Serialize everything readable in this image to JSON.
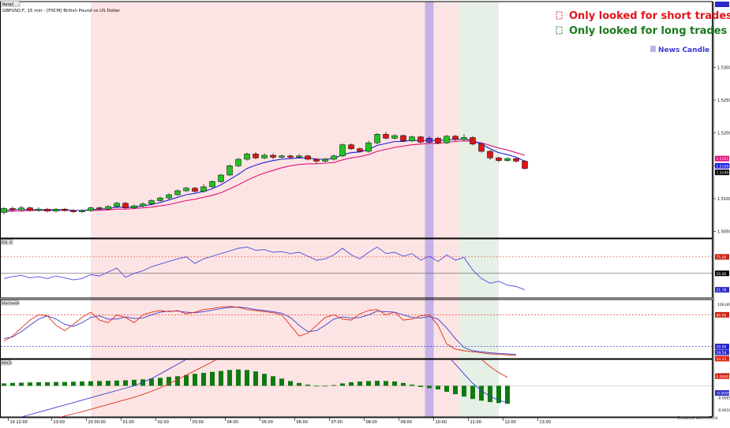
{
  "window": {
    "title_tag": "Retail",
    "symbol_line": "GBPUSD.F, 15 min - [FXCM] British Pound vs US Dollar",
    "footer": "Created with XTick"
  },
  "legend": {
    "short_label": "Only looked for short trades",
    "long_label": "Only looked for long trades",
    "news_label": "News Candle",
    "short_color": "#e4141b",
    "long_color": "#1a7a1a",
    "news_color": "#5a5ae0"
  },
  "colors": {
    "short_zone": "#fde4e4",
    "long_zone": "#e6f0e6",
    "news_band": "#c3b3e6",
    "bull": "#22c322",
    "bear": "#e01515",
    "news_candle": "#6a2fc9",
    "ma_fast": "#1f1fdf",
    "ma_slow": "#e0137a",
    "rsi_line": "#4a4ae0",
    "macd_hist": "#0f7a0f"
  },
  "chart_data": [
    {
      "type": "candlestick",
      "panel": "price",
      "x_unit": "bar index (15 min bars)",
      "ylim": [
        1.504,
        1.54
      ],
      "y_ticks": [
        "1.5300",
        "1.5250",
        "1.5200",
        "1.5150",
        "1.5100",
        "1.5050"
      ],
      "x_ticks": [
        {
          "i": 0,
          "label": "19 22:00"
        },
        {
          "i": 5,
          "label": "23:00"
        },
        {
          "i": 9,
          "label": "20 00:00"
        },
        {
          "i": 13,
          "label": "01:00"
        },
        {
          "i": 17,
          "label": "02:00"
        },
        {
          "i": 21,
          "label": "03:00"
        },
        {
          "i": 25,
          "label": "04:00"
        },
        {
          "i": 29,
          "label": "05:00"
        },
        {
          "i": 33,
          "label": "06:00"
        },
        {
          "i": 37,
          "label": "07:00"
        },
        {
          "i": 41,
          "label": "08:00"
        },
        {
          "i": 45,
          "label": "09:00"
        },
        {
          "i": 49,
          "label": "10:00"
        },
        {
          "i": 53,
          "label": "11:00"
        },
        {
          "i": 57,
          "label": "12:00"
        },
        {
          "i": 61,
          "label": "13:00"
        }
      ],
      "price_badges": [
        {
          "label": "1.5161",
          "value": 1.5161,
          "color": "#e0137a"
        },
        {
          "label": "1.5150",
          "value": 1.515,
          "color": "#1f1fdf"
        },
        {
          "label": "1.5140",
          "value": 1.514,
          "color": "#000000"
        }
      ],
      "shaded_regions": [
        {
          "name": "Only looked for short trades",
          "from": 10,
          "to": 52.5
        },
        {
          "name": "Only looked for long trades",
          "from": 52.5,
          "to": 57
        },
        {
          "name": "News Candle",
          "from": 48.5,
          "to": 49.5
        }
      ],
      "news_candle_index": 49,
      "candles": [
        [
          1.5079,
          1.5085,
          1.5087,
          1.5076
        ],
        [
          1.5085,
          1.5083,
          1.5088,
          1.508
        ],
        [
          1.5083,
          1.5086,
          1.5089,
          1.5081
        ],
        [
          1.5086,
          1.5082,
          1.5088,
          1.508
        ],
        [
          1.5082,
          1.5084,
          1.5087,
          1.508
        ],
        [
          1.5084,
          1.5081,
          1.5086,
          1.5079
        ],
        [
          1.5081,
          1.5084,
          1.5086,
          1.5079
        ],
        [
          1.5084,
          1.5082,
          1.5086,
          1.508
        ],
        [
          1.5082,
          1.508,
          1.5084,
          1.5078
        ],
        [
          1.508,
          1.5082,
          1.5084,
          1.5078
        ],
        [
          1.5082,
          1.5086,
          1.5088,
          1.508
        ],
        [
          1.5086,
          1.5084,
          1.5088,
          1.5082
        ],
        [
          1.5084,
          1.5088,
          1.509,
          1.5082
        ],
        [
          1.5088,
          1.5093,
          1.5095,
          1.5086
        ],
        [
          1.5093,
          1.5086,
          1.5095,
          1.5084
        ],
        [
          1.5086,
          1.5089,
          1.5091,
          1.5084
        ],
        [
          1.5089,
          1.5092,
          1.5094,
          1.5087
        ],
        [
          1.5092,
          1.5097,
          1.5099,
          1.509
        ],
        [
          1.5097,
          1.5101,
          1.5103,
          1.5095
        ],
        [
          1.5101,
          1.5106,
          1.5108,
          1.5099
        ],
        [
          1.5106,
          1.5112,
          1.5114,
          1.5104
        ],
        [
          1.5112,
          1.5116,
          1.5118,
          1.511
        ],
        [
          1.5116,
          1.5111,
          1.5118,
          1.5109
        ],
        [
          1.5111,
          1.5118,
          1.5122,
          1.5109
        ],
        [
          1.5118,
          1.5126,
          1.5128,
          1.5116
        ],
        [
          1.5126,
          1.5136,
          1.5138,
          1.5124
        ],
        [
          1.5136,
          1.515,
          1.5152,
          1.5134
        ],
        [
          1.515,
          1.516,
          1.5162,
          1.5148
        ],
        [
          1.516,
          1.5168,
          1.517,
          1.5158
        ],
        [
          1.5168,
          1.5162,
          1.5171,
          1.516
        ],
        [
          1.5162,
          1.5166,
          1.5169,
          1.516
        ],
        [
          1.5166,
          1.5163,
          1.5169,
          1.516
        ],
        [
          1.5163,
          1.5165,
          1.5167,
          1.5161
        ],
        [
          1.5165,
          1.5163,
          1.5167,
          1.516
        ],
        [
          1.5163,
          1.5165,
          1.5168,
          1.5161
        ],
        [
          1.5165,
          1.516,
          1.5167,
          1.5158
        ],
        [
          1.516,
          1.5157,
          1.5162,
          1.5153
        ],
        [
          1.5157,
          1.516,
          1.5162,
          1.5155
        ],
        [
          1.516,
          1.5165,
          1.5167,
          1.5158
        ],
        [
          1.5165,
          1.5182,
          1.5184,
          1.5163
        ],
        [
          1.5182,
          1.5176,
          1.5184,
          1.5174
        ],
        [
          1.5176,
          1.5172,
          1.5178,
          1.517
        ],
        [
          1.5172,
          1.5185,
          1.5188,
          1.517
        ],
        [
          1.5185,
          1.5198,
          1.52,
          1.5183
        ],
        [
          1.5198,
          1.5192,
          1.5202,
          1.519
        ],
        [
          1.5192,
          1.5196,
          1.5198,
          1.519
        ],
        [
          1.5196,
          1.5188,
          1.5198,
          1.5186
        ],
        [
          1.5188,
          1.5194,
          1.5196,
          1.5186
        ],
        [
          1.5194,
          1.5186,
          1.5196,
          1.5184
        ],
        [
          1.5186,
          1.5192,
          1.5195,
          1.5184
        ],
        [
          1.5192,
          1.5185,
          1.5194,
          1.5183
        ],
        [
          1.5185,
          1.5195,
          1.5197,
          1.5183
        ],
        [
          1.5195,
          1.519,
          1.5197,
          1.5188
        ],
        [
          1.519,
          1.5193,
          1.5198,
          1.5188
        ],
        [
          1.5193,
          1.5183,
          1.5195,
          1.5181
        ],
        [
          1.5183,
          1.5172,
          1.5185,
          1.517
        ],
        [
          1.5172,
          1.5162,
          1.5174,
          1.5159
        ],
        [
          1.5162,
          1.5158,
          1.5164,
          1.5155
        ],
        [
          1.5158,
          1.5161,
          1.5163,
          1.5156
        ],
        [
          1.5161,
          1.5157,
          1.5163,
          1.5155
        ],
        [
          1.5157,
          1.5146,
          1.5159,
          1.5144
        ]
      ],
      "ma_fast": [
        1.5082,
        1.5083,
        1.5084,
        1.5083,
        1.5083,
        1.5083,
        1.5083,
        1.5083,
        1.5082,
        1.5082,
        1.5083,
        1.5084,
        1.5085,
        1.5087,
        1.5087,
        1.5087,
        1.5089,
        1.5091,
        1.5094,
        1.5098,
        1.5102,
        1.5106,
        1.5108,
        1.5111,
        1.5115,
        1.5121,
        1.5129,
        1.5137,
        1.5146,
        1.5151,
        1.5155,
        1.5158,
        1.516,
        1.5161,
        1.5162,
        1.5162,
        1.516,
        1.516,
        1.5161,
        1.5167,
        1.517,
        1.5171,
        1.5175,
        1.5181,
        1.5184,
        1.5187,
        1.5187,
        1.5189,
        1.5188,
        1.5189,
        1.5188,
        1.519,
        1.519,
        1.5191,
        1.5188,
        1.5183,
        1.5176,
        1.517,
        1.5167,
        1.5163,
        1.5157
      ],
      "ma_slow": [
        1.508,
        1.5081,
        1.5081,
        1.5082,
        1.5082,
        1.5082,
        1.5082,
        1.5082,
        1.5082,
        1.5082,
        1.5082,
        1.5082,
        1.5083,
        1.5084,
        1.5084,
        1.5085,
        1.5086,
        1.5087,
        1.5089,
        1.5091,
        1.5094,
        1.5097,
        1.5099,
        1.5102,
        1.5105,
        1.5109,
        1.5115,
        1.5121,
        1.5128,
        1.5134,
        1.5139,
        1.5143,
        1.5147,
        1.515,
        1.5152,
        1.5153,
        1.5153,
        1.5154,
        1.5155,
        1.5159,
        1.5162,
        1.5164,
        1.5167,
        1.5172,
        1.5175,
        1.5178,
        1.518,
        1.5182,
        1.5183,
        1.5184,
        1.5184,
        1.5186,
        1.5187,
        1.5188,
        1.5187,
        1.5185,
        1.5181,
        1.5177,
        1.5174,
        1.517,
        1.5166
      ]
    },
    {
      "type": "line",
      "panel": "RSI",
      "title": "RSI, 8",
      "ylim": [
        15,
        100
      ],
      "levels": [
        {
          "label": "75.00",
          "value": 75
        },
        {
          "label": "50.00",
          "value": 50
        }
      ],
      "last_label": "21.78",
      "values": [
        42,
        45,
        47,
        43,
        45,
        42,
        46,
        43,
        40,
        42,
        48,
        46,
        52,
        58,
        44,
        50,
        54,
        60,
        64,
        68,
        72,
        75,
        65,
        72,
        76,
        80,
        84,
        88,
        90,
        85,
        86,
        82,
        83,
        80,
        82,
        76,
        70,
        72,
        78,
        88,
        78,
        72,
        82,
        90,
        80,
        82,
        76,
        80,
        70,
        76,
        68,
        78,
        70,
        74,
        55,
        42,
        35,
        38,
        32,
        30,
        25
      ]
    },
    {
      "type": "line",
      "panel": "Stochastic",
      "title": "Stochastic",
      "ylim": [
        0,
        100
      ],
      "levels": [
        {
          "label": "80.00",
          "value": 80
        },
        {
          "label": "20.00",
          "value": 20
        }
      ],
      "y_ticks": [
        "100.00",
        "0.00"
      ],
      "last_labels": [
        "19.54",
        "14.23"
      ],
      "k": [
        30,
        40,
        55,
        70,
        80,
        78,
        60,
        50,
        62,
        75,
        85,
        70,
        65,
        80,
        75,
        65,
        80,
        85,
        88,
        86,
        88,
        82,
        85,
        90,
        92,
        95,
        96,
        94,
        90,
        88,
        86,
        84,
        80,
        60,
        40,
        45,
        60,
        75,
        80,
        72,
        70,
        82,
        88,
        90,
        80,
        85,
        70,
        72,
        78,
        80,
        60,
        25,
        15,
        12,
        10,
        8,
        6,
        5,
        4,
        3
      ],
      "d": [
        35,
        38,
        48,
        60,
        72,
        78,
        72,
        62,
        58,
        65,
        75,
        78,
        72,
        72,
        76,
        73,
        74,
        80,
        85,
        87,
        87,
        85,
        84,
        86,
        89,
        92,
        94,
        95,
        93,
        90,
        88,
        86,
        83,
        75,
        60,
        48,
        50,
        60,
        72,
        76,
        74,
        75,
        80,
        87,
        86,
        85,
        80,
        75,
        74,
        77,
        72,
        55,
        35,
        18,
        12,
        10,
        8,
        7,
        6,
        5
      ]
    },
    {
      "type": "bar+line",
      "panel": "MACD",
      "title": "MACD",
      "ylim": [
        -0.0013,
        0.0011
      ],
      "y_ticks": [
        "0.0005",
        "-0.0005",
        "-0.0010"
      ],
      "last_labels": [
        "0.0000",
        "-0.0005"
      ],
      "histogram": [
        0.0001,
        0.00012,
        0.00013,
        0.00014,
        0.00015,
        0.00015,
        0.00016,
        0.00016,
        0.00017,
        0.00018,
        0.00019,
        0.0002,
        0.00021,
        0.00022,
        0.00023,
        0.00025,
        0.00027,
        0.0003,
        0.00033,
        0.00037,
        0.0004,
        0.00045,
        0.0005,
        0.00054,
        0.00058,
        0.00062,
        0.00066,
        0.00068,
        0.00066,
        0.0006,
        0.0005,
        0.0004,
        0.0003,
        0.0002,
        0.00012,
        5e-05,
        0.0,
        -2e-05,
        3e-05,
        0.0001,
        0.00015,
        0.00018,
        0.0002,
        0.00021,
        0.0002,
        0.00018,
        0.00012,
        5e-05,
        -5e-05,
        -0.0001,
        -0.00015,
        -0.00025,
        -0.00035,
        -0.00045,
        -0.00055,
        -0.00062,
        -0.00068,
        -0.00072,
        -0.00075
      ],
      "macd": [
        -0.0015,
        -0.0014,
        -0.0013,
        -0.0012,
        -0.0011,
        -0.001,
        -0.0009,
        -0.0008,
        -0.0007,
        -0.0006,
        -0.0005,
        -0.0004,
        -0.0003,
        -0.0002,
        -0.0001,
        0.0,
        0.00015,
        0.0003,
        0.0005,
        0.0007,
        0.0009,
        0.0011,
        0.0013,
        0.0015,
        0.00175,
        0.002,
        0.0022,
        0.0024,
        0.0026,
        0.0027,
        0.00275,
        0.0027,
        0.0026,
        0.0025,
        0.0024,
        0.0023,
        0.0022,
        0.00215,
        0.0022,
        0.0023,
        0.0024,
        0.00245,
        0.0025,
        0.00252,
        0.0025,
        0.00245,
        0.0024,
        0.0023,
        0.0021,
        0.0019,
        0.0016,
        0.0013,
        0.0009,
        0.0005,
        0.0001,
        -0.0002,
        -0.00045,
        -0.0006,
        -0.0007
      ],
      "signal": [
        -0.0018,
        -0.00175,
        -0.00168,
        -0.0016,
        -0.00152,
        -0.00144,
        -0.00135,
        -0.00126,
        -0.00117,
        -0.00108,
        -0.00098,
        -0.00088,
        -0.00078,
        -0.00068,
        -0.00058,
        -0.00048,
        -0.00036,
        -0.00023,
        -8e-05,
        8e-05,
        0.00026,
        0.00045,
        0.00063,
        0.00081,
        0.001,
        0.0012,
        0.0014,
        0.0016,
        0.0018,
        0.002,
        0.00215,
        0.00225,
        0.00232,
        0.00236,
        0.00238,
        0.00238,
        0.00236,
        0.00232,
        0.0023,
        0.0023,
        0.00232,
        0.00234,
        0.00237,
        0.0024,
        0.00242,
        0.00242,
        0.00242,
        0.0024,
        0.00235,
        0.00228,
        0.00218,
        0.00205,
        0.0019,
        0.00168,
        0.0014,
        0.0011,
        0.0008,
        0.00055,
        0.00035
      ]
    }
  ]
}
